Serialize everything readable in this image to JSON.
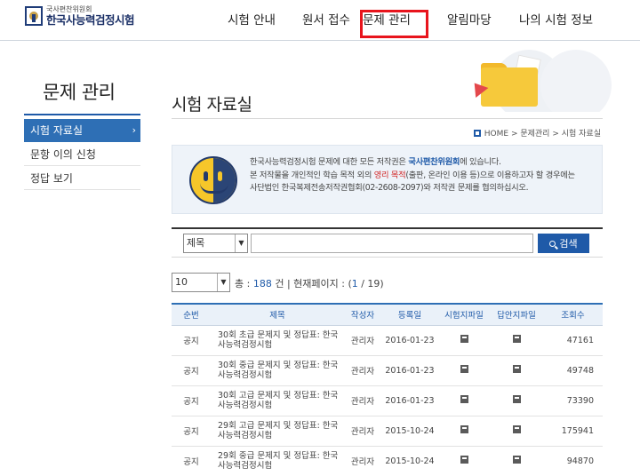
{
  "logo": {
    "small": "국사편찬위원회",
    "big": "한국사능력검정시험"
  },
  "gnb": [
    "시험 안내",
    "원서 접수",
    "문제 관리",
    "알림마당",
    "나의 시험 정보"
  ],
  "sidebar": {
    "title": "문제 관리",
    "items": [
      {
        "label": "시험 자료실",
        "active": true
      },
      {
        "label": "문항 이의 신청"
      },
      {
        "label": "정답 보기"
      }
    ]
  },
  "page": {
    "title": "시험 자료실",
    "breadcrumb": "HOME > 문제관리 > 시험 자료실"
  },
  "notice": {
    "line1_pre": "한국사능력검정시험 문제에 대한 모든 저작권은 ",
    "line1_em": "국사편찬위원회",
    "line1_post": "에 있습니다.",
    "line2_pre": "본 저작물을 개인적인 학습 목적 외의 ",
    "line2_em": "영리 목적",
    "line2_post": "(출판, 온라인 이용 등)으로 이용하고자 할 경우에는",
    "line3": "사단법인 한국복제전송저작권협회(02-2608-2097)와 저작권 문제를 협의하십시오."
  },
  "search": {
    "select_value": "제목",
    "button_label": "검색"
  },
  "paging": {
    "per_page": "10",
    "total_label": "총 : ",
    "total": "188",
    "unit": " 건 | 현재페이지 : (",
    "current": "1",
    "suffix": " / 19)"
  },
  "table": {
    "headers": [
      "순번",
      "제목",
      "작성자",
      "등록일",
      "시험지파일",
      "답안지파일",
      "조회수"
    ],
    "rows": [
      {
        "no": "공지",
        "title": "30회 초급 문제지 및 정답표: 한국사능력검정시험",
        "author": "관리자",
        "date": "2016-01-23",
        "views": "47161"
      },
      {
        "no": "공지",
        "title": "30회 중급 문제지 및 정답표: 한국사능력검정시험",
        "author": "관리자",
        "date": "2016-01-23",
        "views": "49748"
      },
      {
        "no": "공지",
        "title": "30회 고급 문제지 및 정답표: 한국사능력검정시험",
        "author": "관리자",
        "date": "2016-01-23",
        "views": "73390"
      },
      {
        "no": "공지",
        "title": "29회 고급 문제지 및 정답표: 한국사능력검정시험",
        "author": "관리자",
        "date": "2015-10-24",
        "views": "175941"
      },
      {
        "no": "공지",
        "title": "29회 중급 문제지 및 정답표: 한국사능력검정시험",
        "author": "관리자",
        "date": "2015-10-24",
        "views": "94870"
      }
    ]
  }
}
